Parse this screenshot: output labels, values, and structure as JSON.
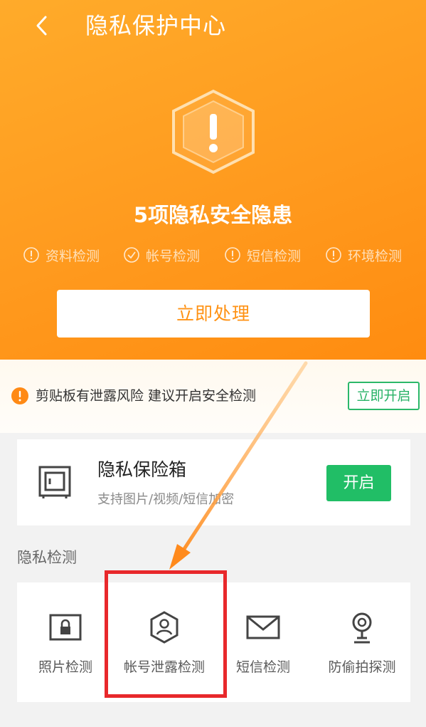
{
  "header": {
    "title": "隐私保护中心",
    "back_icon": "chevron-left-icon"
  },
  "summary": {
    "headline": "5项隐私安全隐患",
    "checks": [
      {
        "label": "资料检测",
        "status_icon": "alert-circle-icon"
      },
      {
        "label": "帐号检测",
        "status_icon": "check-circle-icon"
      },
      {
        "label": "短信检测",
        "status_icon": "alert-circle-icon"
      },
      {
        "label": "环境检测",
        "status_icon": "alert-circle-icon"
      }
    ],
    "action_label": "立即处理"
  },
  "clipboard_warning": {
    "text": "剪贴板有泄露风险 建议开启安全检测",
    "button_label": "立即开启"
  },
  "vault": {
    "title": "隐私保险箱",
    "subtitle": "支持图片/视频/短信加密",
    "button_label": "开启"
  },
  "privacy_check": {
    "section_title": "隐私检测",
    "tools": [
      {
        "label": "照片检测",
        "icon": "photo-lock-icon"
      },
      {
        "label": "帐号泄露检测",
        "icon": "account-shield-icon"
      },
      {
        "label": "短信检测",
        "icon": "envelope-icon"
      },
      {
        "label": "防偷拍探测",
        "icon": "camera-detect-icon"
      }
    ]
  },
  "colors": {
    "hero_orange": "#ff9a1e",
    "accent_green": "#21be66",
    "annotation_red": "#e8282b"
  }
}
